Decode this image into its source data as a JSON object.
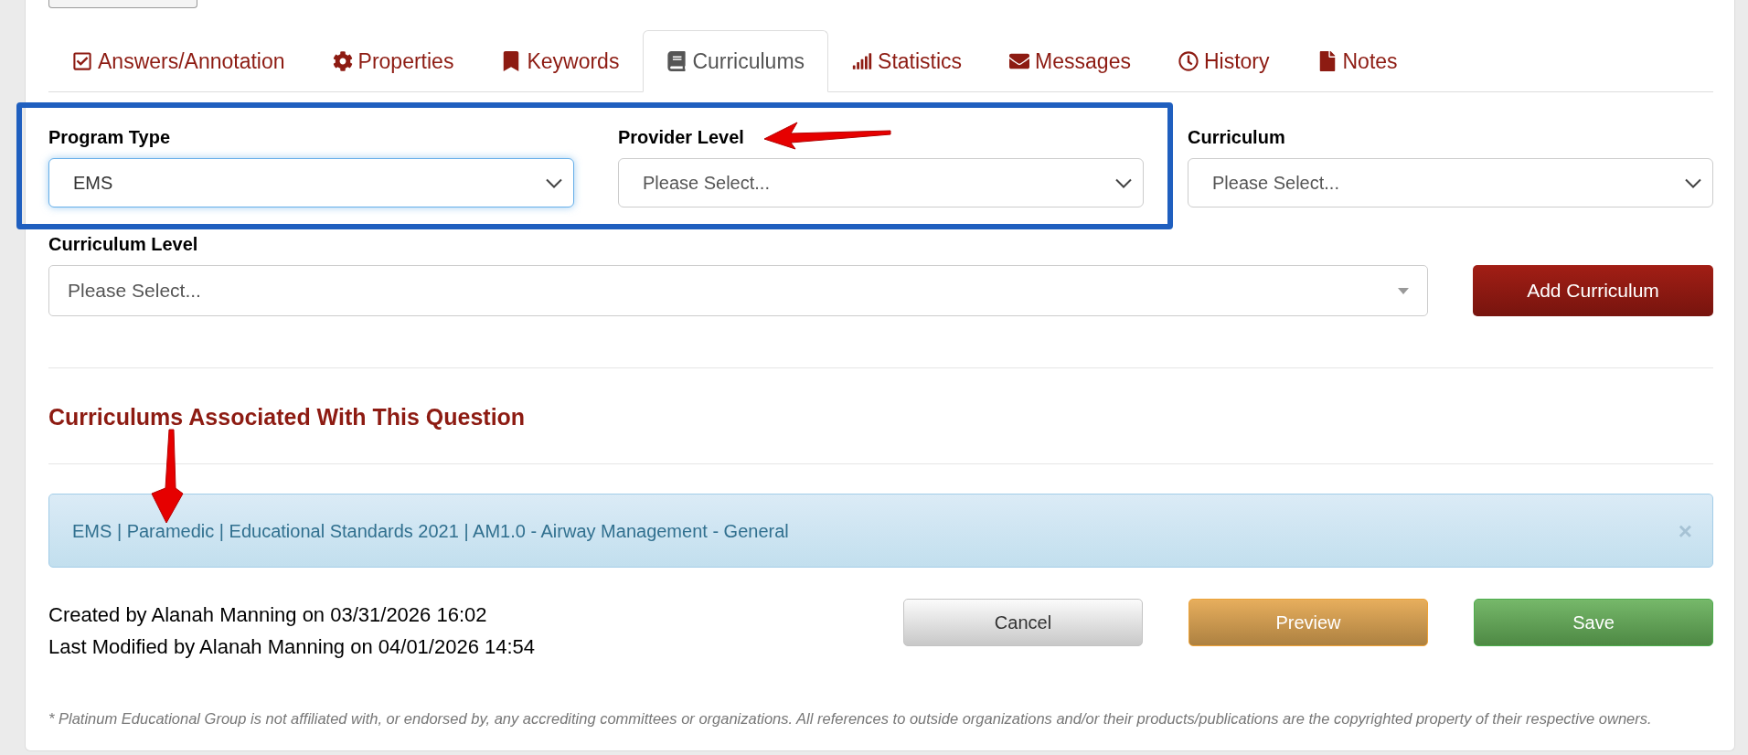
{
  "tabs": [
    {
      "label": "Answers/Annotation",
      "selected": false
    },
    {
      "label": "Properties",
      "selected": false
    },
    {
      "label": "Keywords",
      "selected": false
    },
    {
      "label": "Curriculums",
      "selected": true
    },
    {
      "label": "Statistics",
      "selected": false
    },
    {
      "label": "Messages",
      "selected": false
    },
    {
      "label": "History",
      "selected": false
    },
    {
      "label": "Notes",
      "selected": false
    }
  ],
  "filters": {
    "fields": [
      {
        "label": "Program Type",
        "kind": "select",
        "value": "EMS",
        "focused": true
      },
      {
        "label": "Provider Level",
        "kind": "select",
        "placeholder": "Please Select...",
        "focused": false
      },
      {
        "label": "Curriculum",
        "kind": "select",
        "placeholder": "Please Select...",
        "focused": false
      },
      {
        "label": "Curriculum Level",
        "kind": "combobox",
        "placeholder": "Please Select...",
        "focused": false
      }
    ],
    "add_button": "Add Curriculum"
  },
  "associated": {
    "title": "Curriculums Associated With This Question",
    "items": [
      {
        "text": "EMS | Paramedic | Educational Standards 2021 | AM1.0 - Airway Management - General",
        "close": "×"
      }
    ]
  },
  "audit": [
    "Created by Alanah Manning on 03/31/2026 16:02",
    "Last Modified by Alanah Manning on 04/01/2026 14:54"
  ],
  "actions": [
    {
      "label": "Cancel",
      "kind": "default"
    },
    {
      "label": "Preview",
      "kind": "warning"
    },
    {
      "label": "Save",
      "kind": "success"
    }
  ],
  "disclaimer": "* Platinum Educational Group is not affiliated with, or endorsed by, any accrediting committees or organizations. All references to outside organizations and/or their products/publications are the copyrighted property of their respective owners."
}
